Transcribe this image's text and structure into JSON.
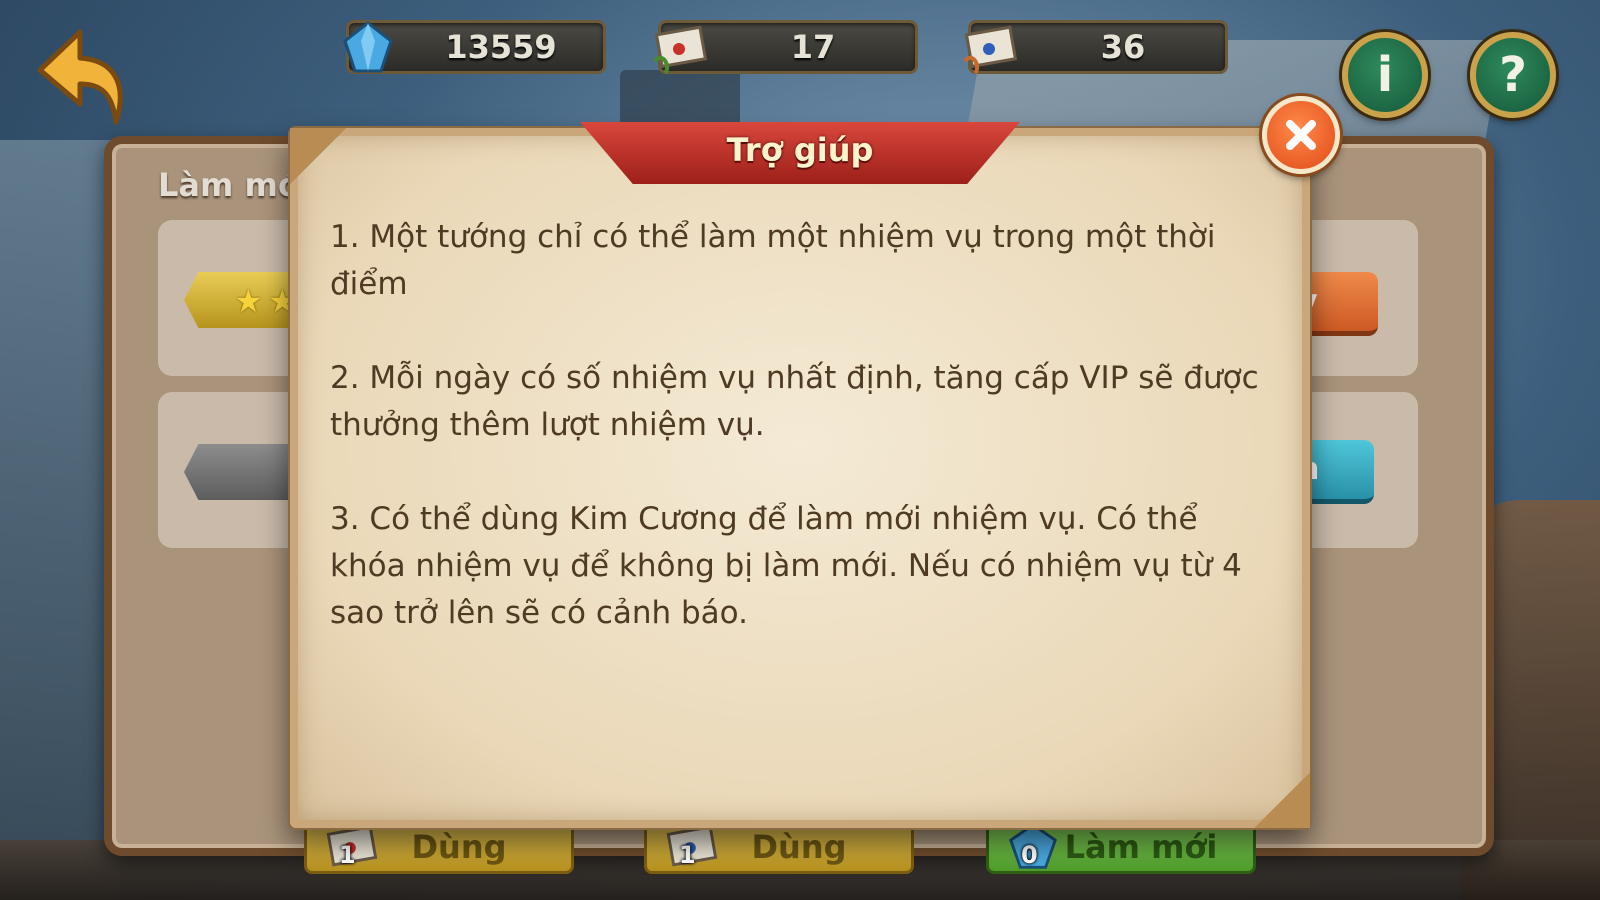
{
  "resources": {
    "diamonds": "13559",
    "scroll_red": "17",
    "scroll_blue": "36"
  },
  "panel": {
    "title": "Làm mới",
    "card1_button_partial": "y",
    "card2_button_partial": "n"
  },
  "dialog": {
    "title": "Trợ giúp",
    "items": [
      "1. Một tướng chỉ có thể làm một nhiệm vụ trong một thời điểm",
      "2. Mỗi ngày có số nhiệm vụ nhất định, tăng cấp VIP sẽ được thưởng thêm lượt nhiệm vụ.",
      "3. Có thể dùng Kim Cương để làm mới nhiệm vụ. Có thể khóa nhiệm vụ để không bị làm mới. Nếu có nhiệm vụ từ 4 sao trở lên sẽ có cảnh báo."
    ]
  },
  "bottom_buttons": {
    "use1_label": "Dùng",
    "use1_count": "1",
    "use2_label": "Dùng",
    "use2_count": "1",
    "refresh_label": "Làm mới",
    "refresh_count": "0"
  },
  "icons": {
    "back": "back-arrow-icon",
    "info": "info-icon",
    "help": "question-icon",
    "close": "close-icon"
  },
  "colors": {
    "ribbon": "#c0342b",
    "close_button": "#e85a1f",
    "info_button": "#1f6e48"
  }
}
